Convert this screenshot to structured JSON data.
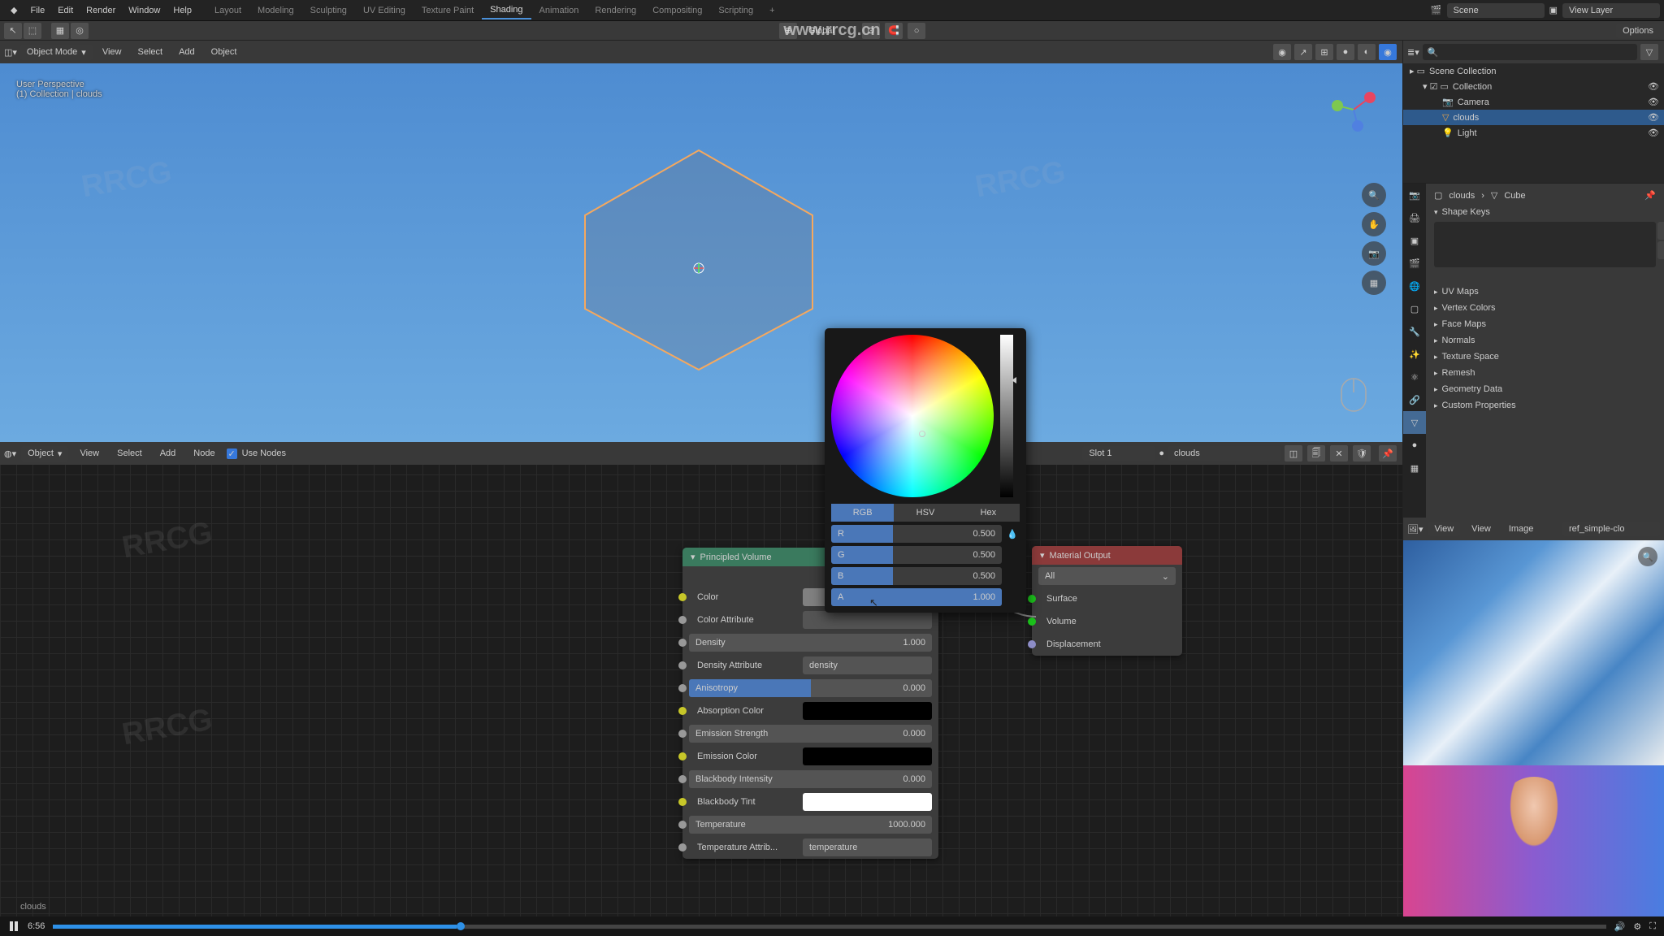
{
  "watermark_url": "www.rrcg.cn",
  "watermark_brand": "RRCG",
  "menu": {
    "file": "File",
    "edit": "Edit",
    "render": "Render",
    "window": "Window",
    "help": "Help"
  },
  "tabs": {
    "layout": "Layout",
    "modeling": "Modeling",
    "sculpting": "Sculpting",
    "uv": "UV Editing",
    "texture": "Texture Paint",
    "shading": "Shading",
    "animation": "Animation",
    "rendering": "Rendering",
    "compositing": "Compositing",
    "scripting": "Scripting"
  },
  "top_scene": "Scene",
  "top_layer": "View Layer",
  "viewport": {
    "mode": "Object Mode",
    "view": "View",
    "select": "Select",
    "add": "Add",
    "object": "Object",
    "persp": "User Perspective",
    "collection": "(1) Collection | clouds",
    "transform_orient": "Global",
    "options": "Options"
  },
  "node_editor": {
    "object_sel": "Object",
    "view": "View",
    "select": "Select",
    "add": "Add",
    "node": "Node",
    "use_nodes": "Use Nodes",
    "slot": "Slot 1",
    "material": "clouds",
    "footer": "clouds"
  },
  "principled_volume": {
    "title": "Principled Volume",
    "color": "Color",
    "color_attr": "Color Attribute",
    "density": "Density",
    "density_val": "1.000",
    "density_attr": "Density Attribute",
    "density_attr_val": "density",
    "anisotropy": "Anisotropy",
    "anisotropy_val": "0.000",
    "absorption": "Absorption Color",
    "emission_str": "Emission Strength",
    "emission_str_val": "0.000",
    "emission_col": "Emission Color",
    "blackbody_int": "Blackbody Intensity",
    "blackbody_int_val": "0.000",
    "blackbody_tint": "Blackbody Tint",
    "temperature": "Temperature",
    "temperature_val": "1000.000",
    "temp_attr": "Temperature Attrib...",
    "temp_attr_val": "temperature"
  },
  "material_output": {
    "title": "Material Output",
    "target": "All",
    "surface": "Surface",
    "volume": "Volume",
    "displacement": "Displacement"
  },
  "color_picker": {
    "rgb": "RGB",
    "hsv": "HSV",
    "hex": "Hex",
    "r": "R",
    "g": "G",
    "b": "B",
    "a": "A",
    "r_val": "0.500",
    "g_val": "0.500",
    "b_val": "0.500",
    "a_val": "1.000"
  },
  "outliner": {
    "scene": "Scene Collection",
    "collection": "Collection",
    "camera": "Camera",
    "clouds": "clouds",
    "light": "Light"
  },
  "props": {
    "obj_name": "clouds",
    "cube": "Cube",
    "shape_keys": "Shape Keys",
    "uv_maps": "UV Maps",
    "vertex_colors": "Vertex Colors",
    "face_maps": "Face Maps",
    "normals": "Normals",
    "texture_space": "Texture Space",
    "remesh": "Remesh",
    "geometry_data": "Geometry Data",
    "custom_props": "Custom Properties"
  },
  "img_viewer": {
    "view_mode": "View",
    "view": "View",
    "image": "Image",
    "img_name": "ref_simple-clo"
  },
  "video": {
    "time": "6:56"
  }
}
